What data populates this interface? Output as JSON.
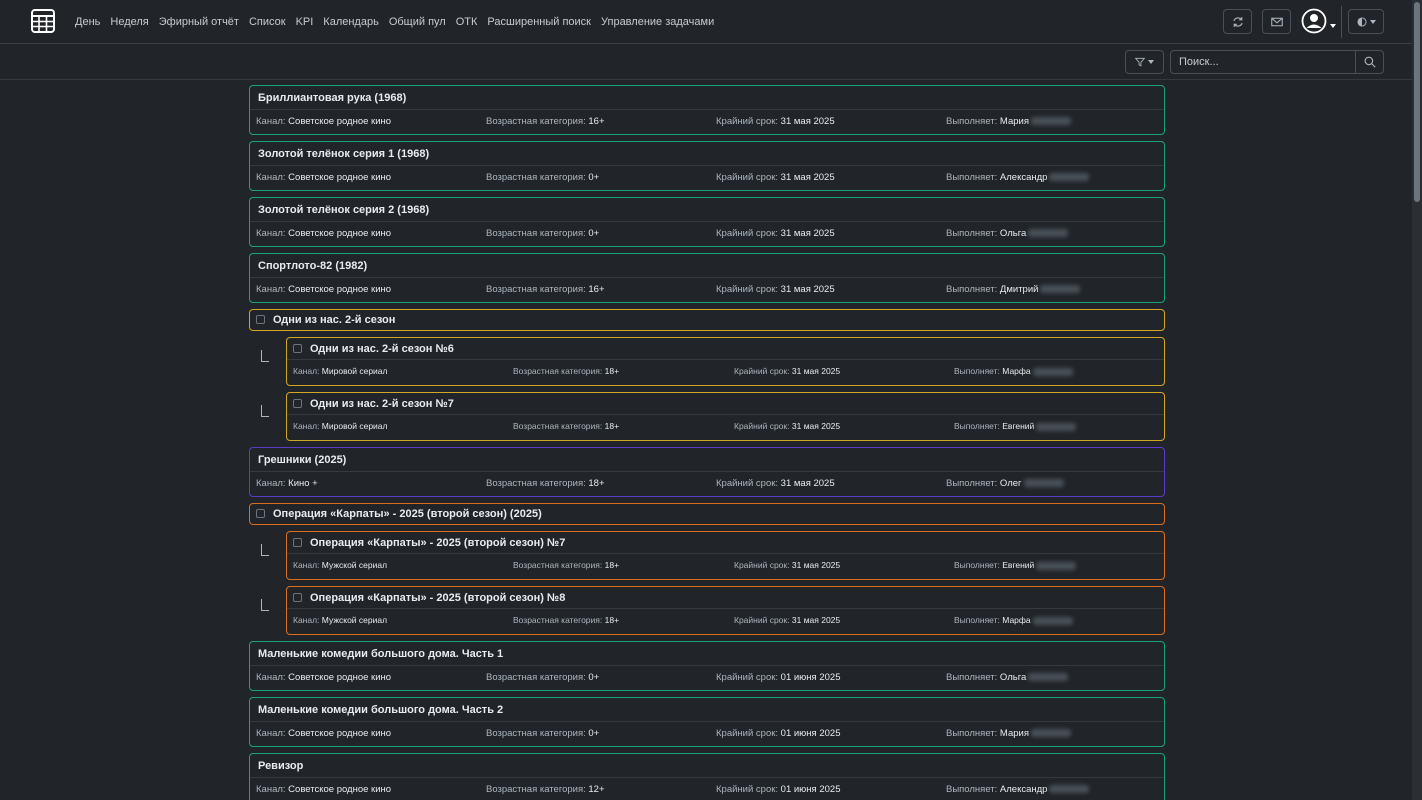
{
  "nav": {
    "items": [
      "День",
      "Неделя",
      "Эфирный отчёт",
      "Список",
      "KPI",
      "Календарь",
      "Общий пул",
      "ОТК",
      "Расширенный поиск",
      "Управление задачами"
    ]
  },
  "search": {
    "placeholder": "Поиск..."
  },
  "labels": {
    "channel": "Канал:",
    "age": "Возрастная категория:",
    "deadline": "Крайний срок:",
    "assignee": "Выполняет:"
  },
  "colors": {
    "green": "#1aa37a",
    "yellow": "#d3a625",
    "purple": "#5b3cc4",
    "orange": "#d96f1f"
  },
  "tasks": [
    {
      "title": "Бриллиантовая рука (1968)",
      "channel": "Советское родное кино",
      "age": "16+",
      "deadline": "31 мая 2025",
      "assignee": "Мария",
      "color": "green"
    },
    {
      "title": "Золотой телёнок серия 1 (1968)",
      "channel": "Советское родное кино",
      "age": "0+",
      "deadline": "31 мая 2025",
      "assignee": "Александр",
      "color": "green"
    },
    {
      "title": "Золотой телёнок серия 2 (1968)",
      "channel": "Советское родное кино",
      "age": "0+",
      "deadline": "31 мая 2025",
      "assignee": "Ольга",
      "color": "green"
    },
    {
      "title": "Спортлото-82 (1982)",
      "channel": "Советское родное кино",
      "age": "16+",
      "deadline": "31 мая 2025",
      "assignee": "Дмитрий",
      "color": "green"
    },
    {
      "title": "Одни из нас. 2-й сезон",
      "parent": true,
      "color": "yellow"
    },
    {
      "title": "Одни из нас. 2-й сезон №6",
      "child": true,
      "channel": "Мировой сериал",
      "age": "18+",
      "deadline": "31 мая 2025",
      "assignee": "Марфа",
      "color": "yellow"
    },
    {
      "title": "Одни из нас. 2-й сезон №7",
      "child": true,
      "channel": "Мировой сериал",
      "age": "18+",
      "deadline": "31 мая 2025",
      "assignee": "Евгений",
      "color": "yellow"
    },
    {
      "title": "Грешники (2025)",
      "channel": "Кино +",
      "age": "18+",
      "deadline": "31 мая 2025",
      "assignee": "Олег",
      "color": "purple"
    },
    {
      "title": "Операция «Карпаты» - 2025 (второй сезон) (2025)",
      "parent": true,
      "color": "orange"
    },
    {
      "title": "Операция «Карпаты» - 2025 (второй сезон) №7",
      "child": true,
      "channel": "Мужской сериал",
      "age": "18+",
      "deadline": "31 мая 2025",
      "assignee": "Евгений",
      "color": "orange"
    },
    {
      "title": "Операция «Карпаты» - 2025 (второй сезон) №8",
      "child": true,
      "channel": "Мужской сериал",
      "age": "18+",
      "deadline": "31 мая 2025",
      "assignee": "Марфа",
      "color": "orange"
    },
    {
      "title": "Маленькие комедии большого дома. Часть 1",
      "channel": "Советское родное кино",
      "age": "0+",
      "deadline": "01 июня 2025",
      "assignee": "Ольга",
      "color": "green"
    },
    {
      "title": "Маленькие комедии большого дома. Часть 2",
      "channel": "Советское родное кино",
      "age": "0+",
      "deadline": "01 июня 2025",
      "assignee": "Мария",
      "color": "green"
    },
    {
      "title": "Ревизор",
      "channel": "Советское родное кино",
      "age": "12+",
      "deadline": "01 июня 2025",
      "assignee": "Александр",
      "color": "green"
    }
  ]
}
